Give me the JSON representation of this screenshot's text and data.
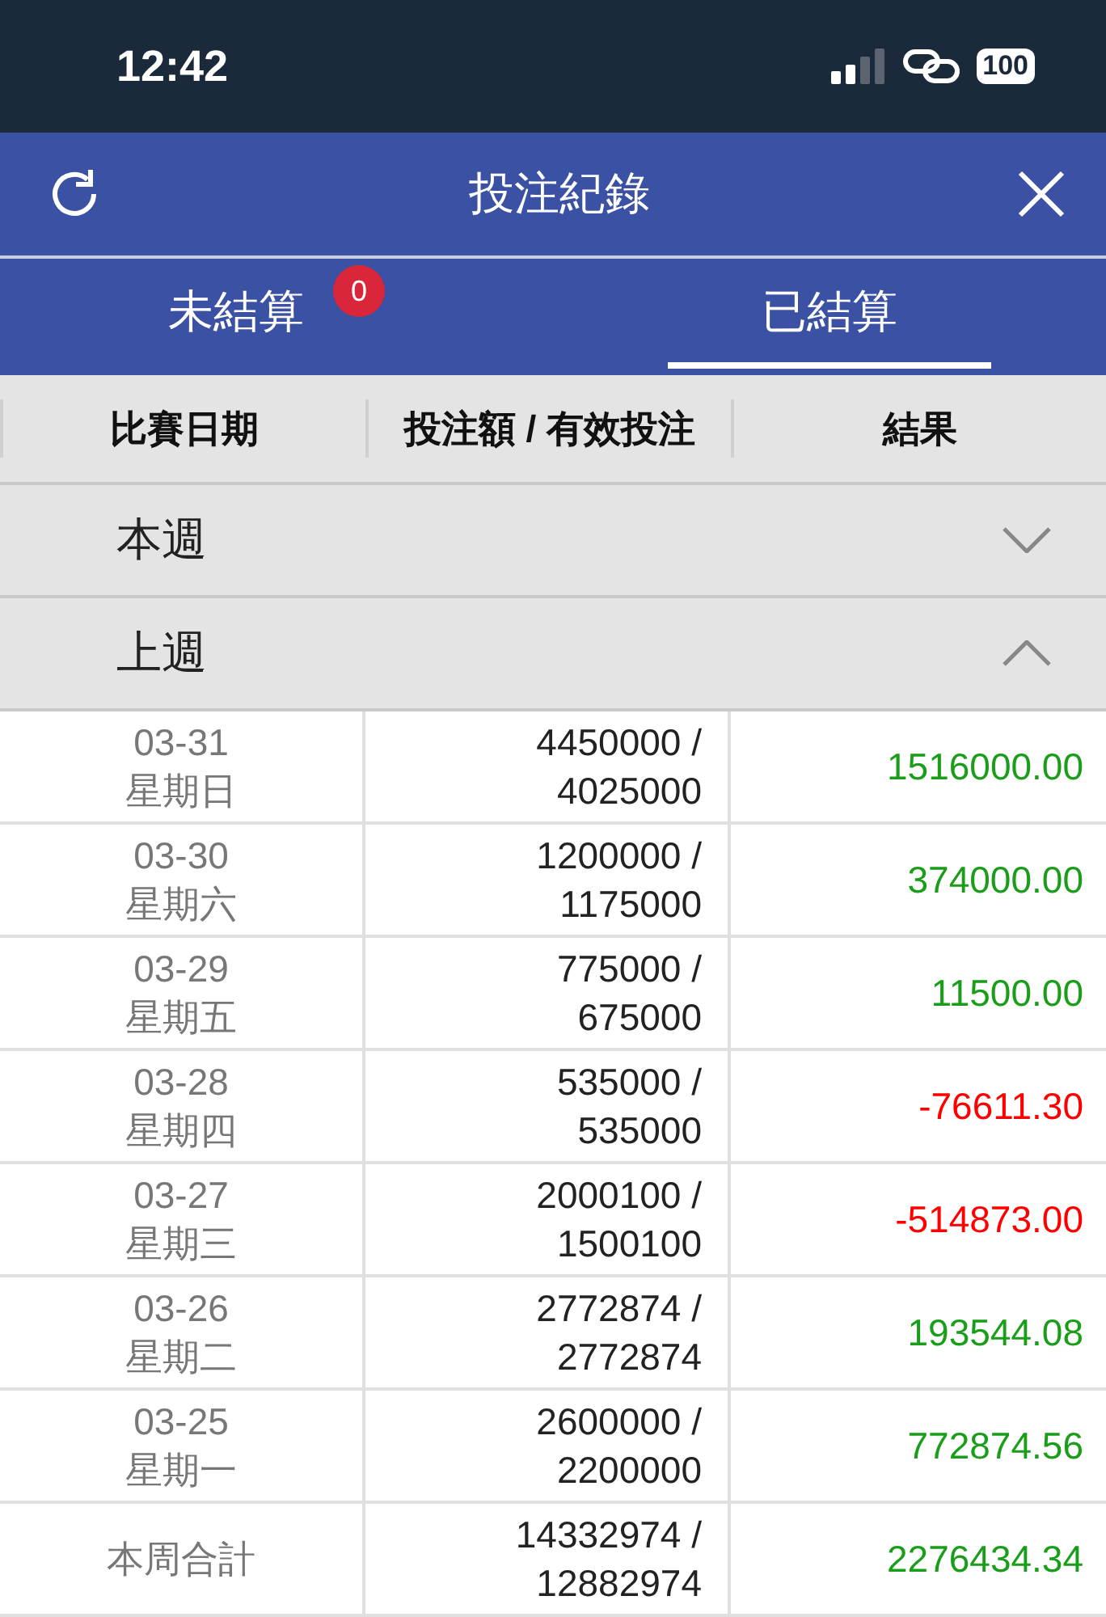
{
  "status_bar": {
    "time": "12:42",
    "battery": "100"
  },
  "header": {
    "title": "投注紀錄"
  },
  "tabs": [
    {
      "label": "未結算",
      "selected": false,
      "badge": "0"
    },
    {
      "label": "已結算",
      "selected": true
    }
  ],
  "table": {
    "columns": [
      "比賽日期",
      "投注額 / 有效投注",
      "結果"
    ],
    "groups": [
      {
        "label": "本週",
        "expanded": false
      },
      {
        "label": "上週",
        "expanded": true,
        "rows": [
          {
            "date": "03-31",
            "weekday": "星期日",
            "stake": "4450000 /",
            "effective": "4025000",
            "result": "1516000.00",
            "color": "#1a9e1a"
          },
          {
            "date": "03-30",
            "weekday": "星期六",
            "stake": "1200000 /",
            "effective": "1175000",
            "result": "374000.00",
            "color": "#1a9e1a"
          },
          {
            "date": "03-29",
            "weekday": "星期五",
            "stake": "775000 /",
            "effective": "675000",
            "result": "11500.00",
            "color": "#1a9e1a"
          },
          {
            "date": "03-28",
            "weekday": "星期四",
            "stake": "535000 /",
            "effective": "535000",
            "result": "-76611.30",
            "color": "#ff0000"
          },
          {
            "date": "03-27",
            "weekday": "星期三",
            "stake": "2000100 /",
            "effective": "1500100",
            "result": "-514873.00",
            "color": "#ff0000"
          },
          {
            "date": "03-26",
            "weekday": "星期二",
            "stake": "2772874 /",
            "effective": "2772874",
            "result": "193544.08",
            "color": "#1a9e1a"
          },
          {
            "date": "03-25",
            "weekday": "星期一",
            "stake": "2600000 /",
            "effective": "2200000",
            "result": "772874.56",
            "color": "#1a9e1a"
          }
        ],
        "total": {
          "label": "本周合計",
          "stake": "14332974 /",
          "effective": "12882974",
          "result": "2276434.34",
          "color": "#1a9e1a"
        }
      }
    ]
  }
}
